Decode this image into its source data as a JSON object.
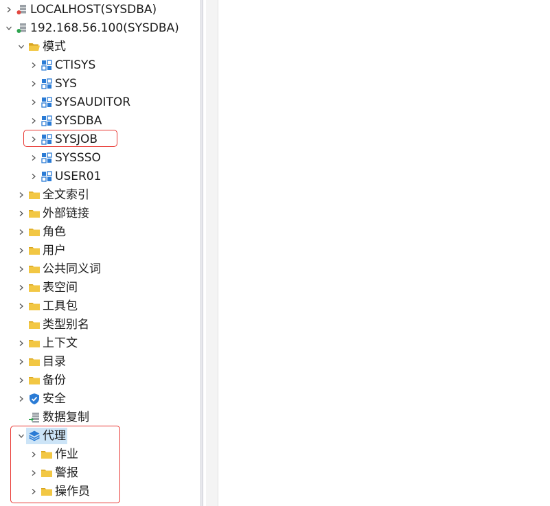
{
  "tree": {
    "servers": [
      {
        "label": "LOCALHOST(SYSDBA)",
        "expanded": false
      },
      {
        "label": "192.168.56.100(SYSDBA)",
        "expanded": true
      }
    ],
    "schema_folder": {
      "label": "模式",
      "expanded": true
    },
    "schemas": [
      {
        "label": "CTISYS"
      },
      {
        "label": "SYS"
      },
      {
        "label": "SYSAUDITOR"
      },
      {
        "label": "SYSDBA"
      },
      {
        "label": "SYSJOB",
        "highlighted": true
      },
      {
        "label": "SYSSSO"
      },
      {
        "label": "USER01"
      }
    ],
    "folders": [
      {
        "label": "全文索引",
        "has_children": true
      },
      {
        "label": "外部链接",
        "has_children": true
      },
      {
        "label": "角色",
        "has_children": true
      },
      {
        "label": "用户",
        "has_children": true
      },
      {
        "label": "公共同义词",
        "has_children": true
      },
      {
        "label": "表空间",
        "has_children": true
      },
      {
        "label": "工具包",
        "has_children": true
      },
      {
        "label": "类型别名",
        "has_children": false
      },
      {
        "label": "上下文",
        "has_children": true
      },
      {
        "label": "目录",
        "has_children": true
      },
      {
        "label": "备份",
        "has_children": true
      },
      {
        "label": "安全",
        "has_children": true,
        "icon": "shield-check-icon"
      },
      {
        "label": "数据复制",
        "has_children": false,
        "icon": "replication-icon"
      }
    ],
    "agent": {
      "label": "代理",
      "expanded": true,
      "selected": true,
      "icon": "layers-icon"
    },
    "agent_children": [
      {
        "label": "作业"
      },
      {
        "label": "警报"
      },
      {
        "label": "操作员"
      }
    ]
  },
  "colors": {
    "folder_yellow": "#f2c744",
    "folder_dark": "#d9a520",
    "schema_blue": "#2a7bd5",
    "highlight_red": "#e8342f",
    "selected_bg": "#cce4f7",
    "server_red": "#e2473f",
    "server_green": "#2ea44f"
  }
}
